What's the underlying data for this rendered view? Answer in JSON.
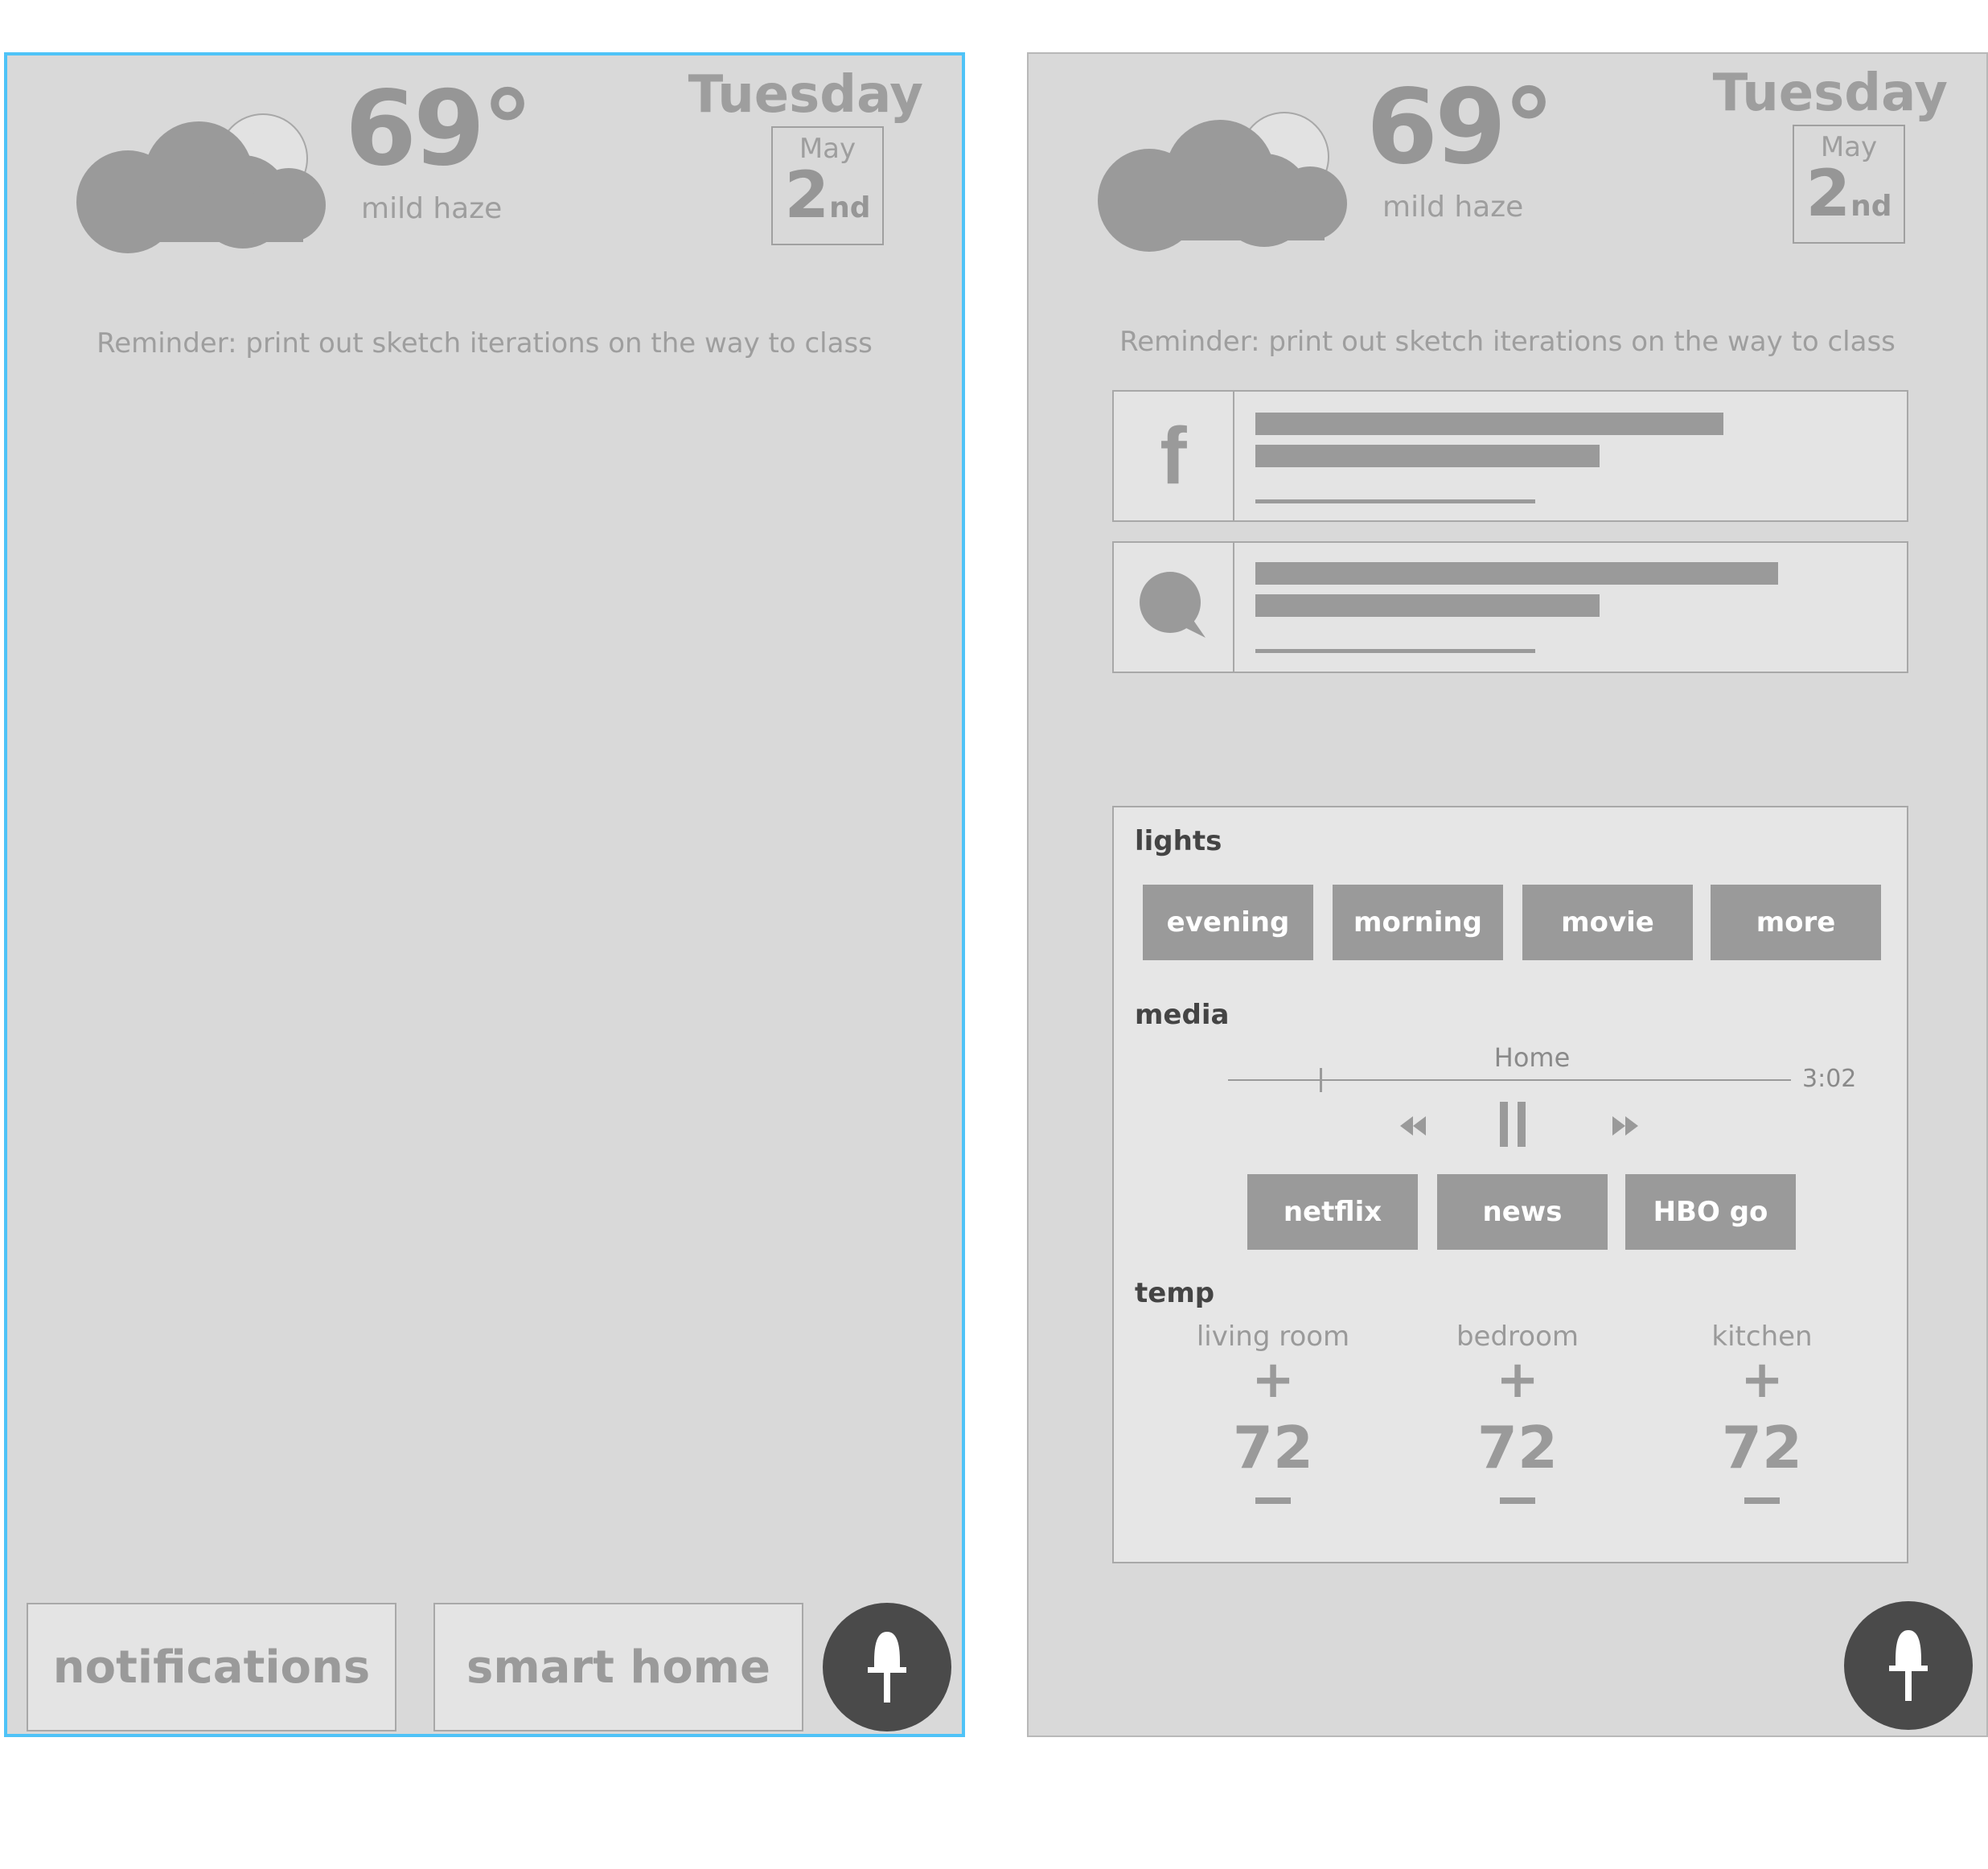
{
  "weather": {
    "temperature": "69°",
    "condition": "mild haze"
  },
  "date": {
    "day_name": "Tuesday",
    "month": "May",
    "day": "2",
    "suffix": "nd"
  },
  "reminder": "Reminder: print out sketch iterations on the way to class",
  "bottom_nav": {
    "notifications_label": "notifications",
    "smart_home_label": "smart home"
  },
  "fab": {
    "icon": "microphone-icon"
  },
  "feed": {
    "facebook_glyph": "f",
    "items": [
      {
        "icon": "facebook-icon"
      },
      {
        "icon": "message-bubble-icon"
      }
    ]
  },
  "smart_home": {
    "lights": {
      "label": "lights",
      "presets": [
        "evening",
        "morning",
        "movie",
        "more"
      ]
    },
    "media": {
      "label": "media",
      "track_title": "Home",
      "duration": "3:02",
      "services": [
        "netflix",
        "news",
        "HBO go"
      ]
    },
    "temp": {
      "label": "temp",
      "rooms": [
        {
          "name": "living room",
          "value": "72"
        },
        {
          "name": "bedroom",
          "value": "72"
        },
        {
          "name": "kitchen",
          "value": "72"
        }
      ],
      "plus": "+"
    }
  },
  "colors": {
    "selection_border": "#4fc3f7",
    "fab": "#4a4a4a",
    "screen_bg": "#d9d9d9"
  }
}
